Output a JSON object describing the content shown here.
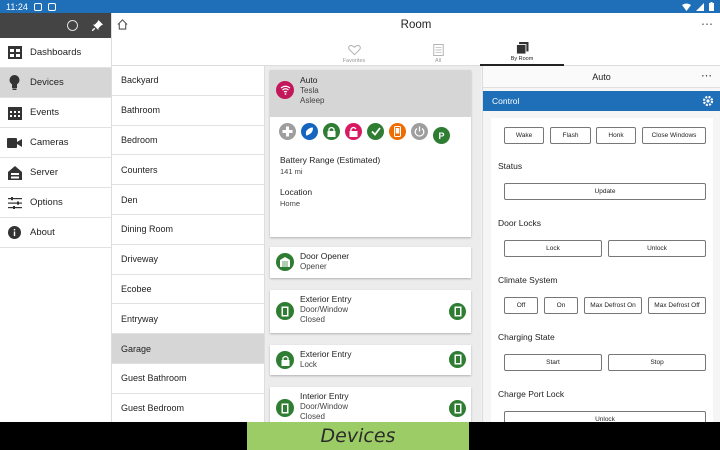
{
  "status_bar": {
    "time": "11:24"
  },
  "sidebar": {
    "items": [
      {
        "label": "Dashboards",
        "icon": "dashboards-icon"
      },
      {
        "label": "Devices",
        "icon": "lightbulb-icon"
      },
      {
        "label": "Events",
        "icon": "calendar-icon"
      },
      {
        "label": "Cameras",
        "icon": "camera-icon"
      },
      {
        "label": "Server",
        "icon": "server-icon"
      },
      {
        "label": "Options",
        "icon": "sliders-icon"
      },
      {
        "label": "About",
        "icon": "info-icon"
      }
    ],
    "active": "Devices"
  },
  "header": {
    "title": "Room",
    "tabs": [
      {
        "label": "Favorites",
        "icon": "heart-icon"
      },
      {
        "label": "All",
        "icon": "list-icon"
      },
      {
        "label": "By Room",
        "icon": "stack-icon"
      }
    ],
    "active_tab": "By Room"
  },
  "rooms": [
    "Backyard",
    "Bathroom",
    "Bedroom",
    "Counters",
    "Den",
    "Dining Room",
    "Driveway",
    "Ecobee",
    "Entryway",
    "Garage",
    "Guest Bathroom",
    "Guest Bedroom"
  ],
  "active_room": "Garage",
  "devices": {
    "auto": {
      "name": "Auto",
      "line2": "Tesla",
      "line3": "Asleep",
      "battery_label": "Battery Range (Estimated)",
      "battery_value": "141 mi",
      "location_label": "Location",
      "location_value": "Home",
      "parking_glyph": "P"
    },
    "door_opener": {
      "name": "Door Opener",
      "line2": "Opener"
    },
    "exterior_entry_1": {
      "name": "Exterior Entry",
      "line2": "Door/Window",
      "line3": "Closed"
    },
    "exterior_entry_2": {
      "name": "Exterior Entry",
      "line2": "Lock"
    },
    "interior_entry": {
      "name": "Interior Entry",
      "line2": "Door/Window",
      "line3": "Closed"
    }
  },
  "panel": {
    "title": "Auto",
    "control_title": "Control",
    "top_buttons": [
      "Wake",
      "Flash",
      "Honk",
      "Close Windows"
    ],
    "status_title": "Status",
    "status_button": "Update",
    "door_locks_title": "Door Locks",
    "door_lock_buttons": [
      "Lock",
      "Unlock"
    ],
    "climate_title": "Climate System",
    "climate_buttons": [
      "Off",
      "On",
      "Max Defrost On",
      "Max Defrost Off"
    ],
    "charging_title": "Charging State",
    "charging_buttons": [
      "Start",
      "Stop"
    ],
    "charge_port_title": "Charge Port Lock",
    "charge_port_button": "Unlock"
  },
  "caption": "Devices",
  "colors": {
    "accent": "#1f6fb8",
    "caption_bg": "#9ccc65",
    "lock_green": "#2e7d32",
    "unlock_red": "#d81b60",
    "tesla_red": "#c2185b",
    "info_blue": "#1565c0",
    "orange": "#ef6c00",
    "gray": "#9e9e9e"
  }
}
